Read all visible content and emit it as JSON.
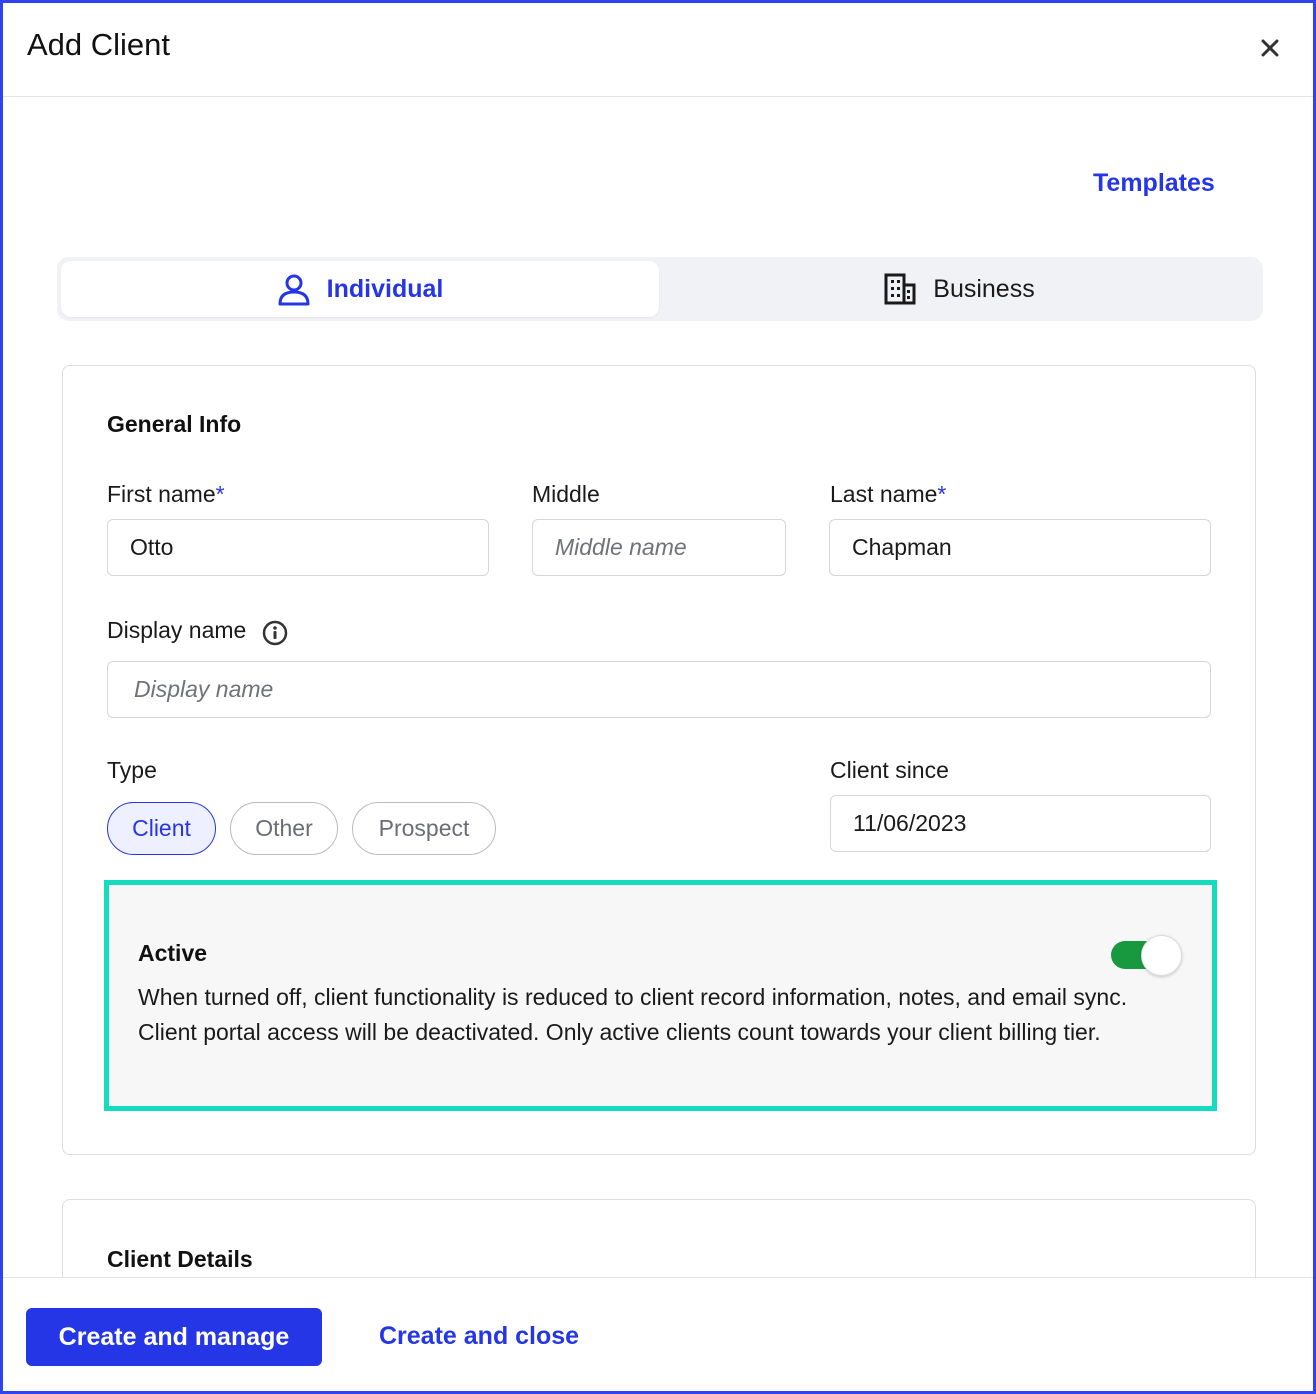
{
  "modal": {
    "title": "Add Client",
    "templates_link": "Templates"
  },
  "client_type_tabs": {
    "individual": "Individual",
    "business": "Business",
    "selected": "Individual"
  },
  "general_info": {
    "heading": "General Info",
    "first_name": {
      "label": "First name",
      "required_mark": "*",
      "value": "Otto"
    },
    "middle": {
      "label": "Middle",
      "placeholder": "Middle name",
      "value": ""
    },
    "last_name": {
      "label": "Last name",
      "required_mark": "*",
      "value": "Chapman"
    },
    "display_name": {
      "label": "Display name",
      "placeholder": "Display name",
      "value": ""
    },
    "type": {
      "label": "Type",
      "options": [
        "Client",
        "Other",
        "Prospect"
      ],
      "selected": "Client"
    },
    "client_since": {
      "label": "Client since",
      "value": "11/06/2023"
    },
    "active": {
      "title": "Active",
      "description": "When turned off, client functionality is reduced to client record information, notes, and email sync. Client portal access will be deactivated. Only active clients count towards your client billing tier.",
      "enabled": true
    }
  },
  "client_details": {
    "heading": "Client Details"
  },
  "footer": {
    "primary_button": "Create and manage",
    "secondary_link": "Create and close"
  },
  "colors": {
    "accent": "#2536e6",
    "toggle_on": "#18993f",
    "highlight_border": "#14dcbf",
    "frame_border": "#2f44f0"
  },
  "icons": {
    "close": "close-icon",
    "individual": "user-icon",
    "business": "building-icon",
    "display_name_info": "info-icon"
  }
}
